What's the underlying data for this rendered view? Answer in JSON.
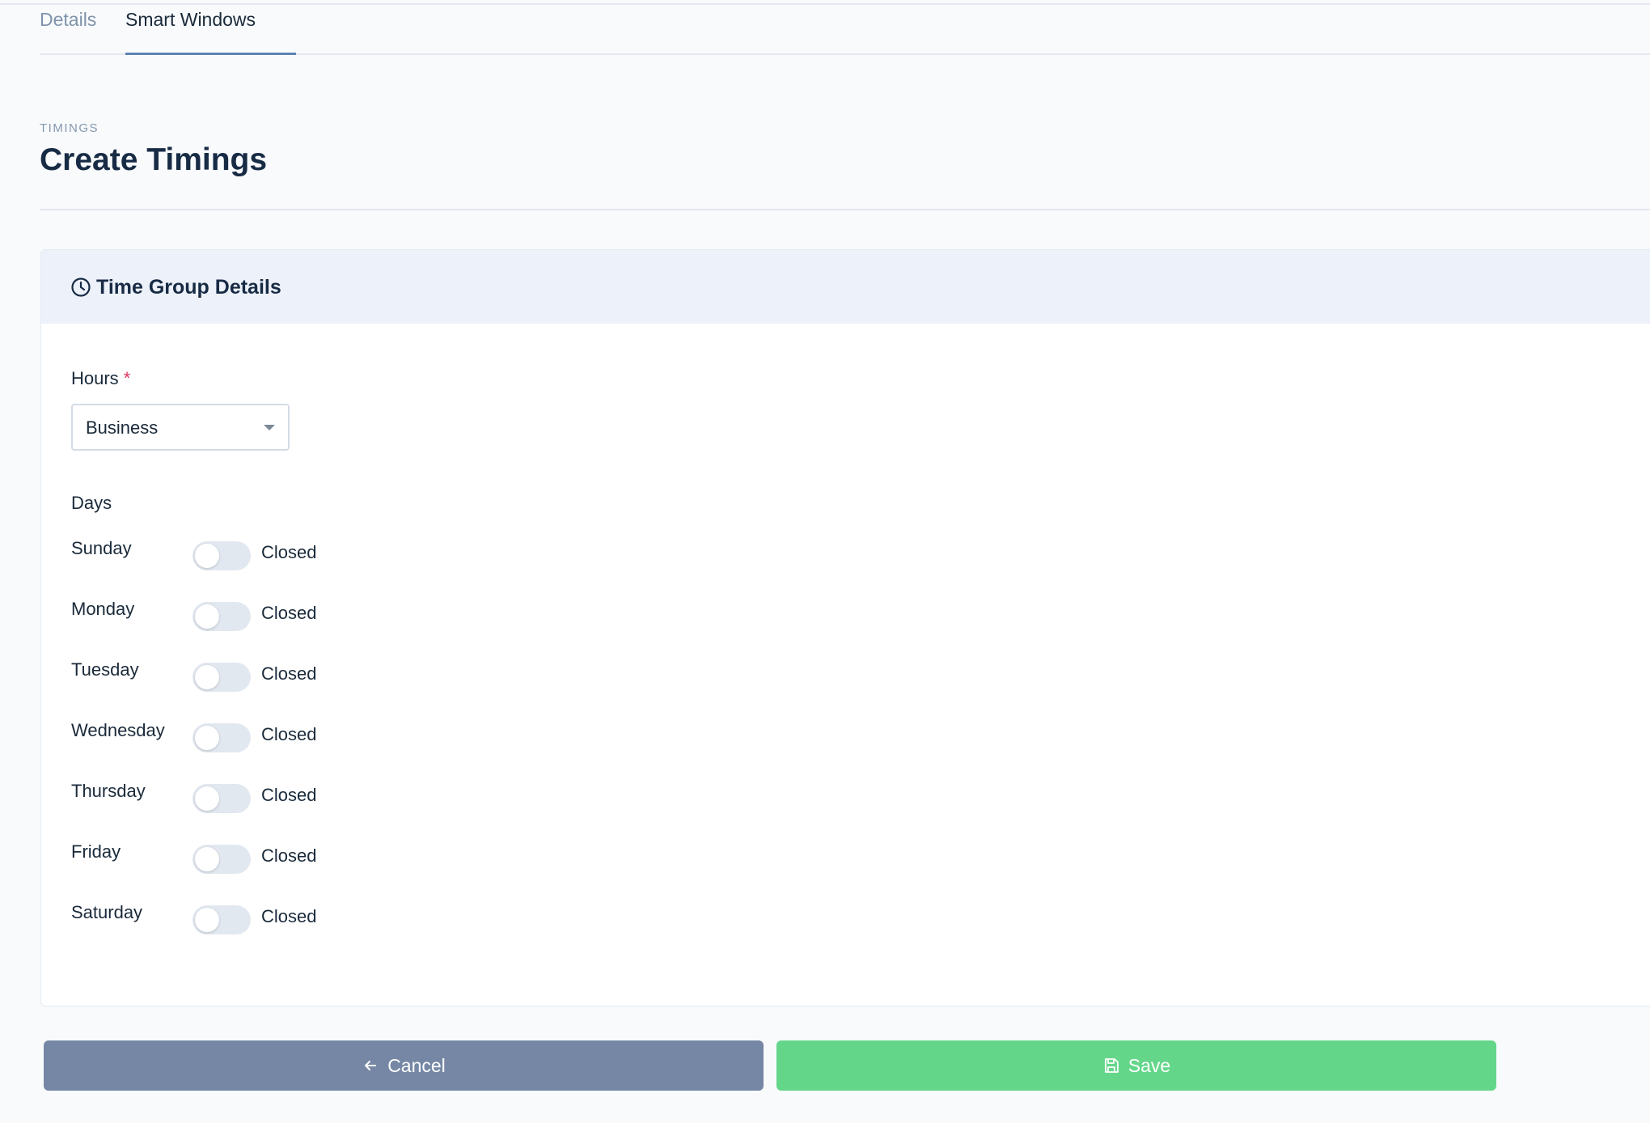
{
  "tabs": [
    {
      "label": "Details",
      "active": false
    },
    {
      "label": "Smart Windows",
      "active": true
    }
  ],
  "header": {
    "eyebrow": "TIMINGS",
    "title": "Create Timings"
  },
  "card": {
    "icon": "clock-icon",
    "title": "Time Group Details",
    "hours": {
      "label": "Hours",
      "required_mark": "*",
      "selected": "Business"
    },
    "days_label": "Days",
    "days": [
      {
        "name": "Sunday",
        "status": "Closed",
        "enabled": false
      },
      {
        "name": "Monday",
        "status": "Closed",
        "enabled": false
      },
      {
        "name": "Tuesday",
        "status": "Closed",
        "enabled": false
      },
      {
        "name": "Wednesday",
        "status": "Closed",
        "enabled": false
      },
      {
        "name": "Thursday",
        "status": "Closed",
        "enabled": false
      },
      {
        "name": "Friday",
        "status": "Closed",
        "enabled": false
      },
      {
        "name": "Saturday",
        "status": "Closed",
        "enabled": false
      }
    ]
  },
  "actions": {
    "cancel_label": "Cancel",
    "cancel_icon": "arrow-left-icon",
    "save_label": "Save",
    "save_icon": "save-icon"
  },
  "colors": {
    "accent": "#5f82b3",
    "cancel_bg": "#7587a4",
    "save_bg": "#64d68a",
    "required": "#e0365a",
    "toggle_off": "#e2e8f0"
  }
}
